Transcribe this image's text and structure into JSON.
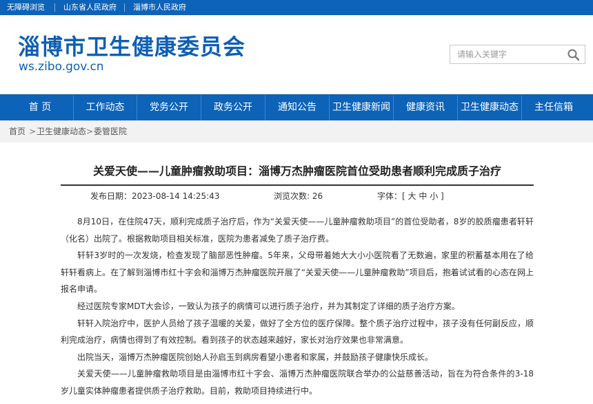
{
  "topbar": {
    "links": [
      "无障碍浏览",
      "山东省人民政府",
      "淄博市人民政府"
    ]
  },
  "header": {
    "title": "淄博市卫生健康委员会",
    "domain": "ws.zibo.gov.cn"
  },
  "search": {
    "placeholder": "请输入关键字",
    "value": "",
    "icon": "search-icon"
  },
  "nav": {
    "items": [
      "首 页",
      "工作动态",
      "党务公开",
      "政务公开",
      "通知公告",
      "卫生健康新闻",
      "健康资讯",
      "卫生健康动态",
      "主任信箱"
    ]
  },
  "breadcrumb": {
    "items": [
      "首页",
      "卫生健康动态",
      "委管医院"
    ],
    "separator": ">"
  },
  "article": {
    "title": "关爱天使——儿童肿瘤救助项目：淄博万杰肿瘤医院首位受助患者顺利完成质子治疗",
    "publish_label": "发布日期：",
    "publish_date": "2023-08-14 14:25:43",
    "views_label": "浏览次数: ",
    "views": "26",
    "font_label": "字体：[",
    "font_large": "大",
    "font_medium": "中",
    "font_small": "小",
    "font_end": "]",
    "paragraphs": [
      "8月10日，在住院47天，顺利完成质子治疗后，作为“关爱天使——儿童肿瘤救助项目”的首位受助者，8岁的胶质瘤患者轩轩（化名）出院了。根据救助项目相关标准，医院为患者减免了质子治疗费。",
      "轩轩3岁时的一次发烧，检查发现了脑部恶性肿瘤。5年来，父母带着她大大小小医院看了无数遍，家里的积蓄基本用在了给轩轩看病上。在了解到淄博市红十字会和淄博万杰肿瘤医院开展了“关爱天使——儿童肿瘤救助”项目后，抱着试试看的心态在网上报名申请。",
      "经过医院专家MDT大会诊，一致认为孩子的病情可以进行质子治疗，并为其制定了详细的质子治疗方案。",
      "轩轩入院治疗中，医护人员给了孩子温暖的关爱，做好了全方位的医疗保障。整个质子治疗过程中，孩子没有任何副反应，顺利完成治疗，病情也得到了有效控制。看到孩子的状态越来越好，家长对治疗效果也非常满意。",
      "出院当天，淄博万杰肿瘤医院创始人孙启玉到病房看望小患者和家属，并鼓励孩子健康快乐成长。",
      "关爱天使——儿童肿瘤救助项目是由淄博市红十字会、淄博万杰肿瘤医院联合举办的公益慈善活动，旨在为符合条件的3-18岁儿童实体肿瘤患者提供质子治疗救助。目前，救助项目持续进行中。"
    ]
  },
  "colors": {
    "brand_blue": "#0d63b8",
    "title_blue": "#0d5fb3",
    "breadcrumb_bg": "#f2f2f2"
  }
}
